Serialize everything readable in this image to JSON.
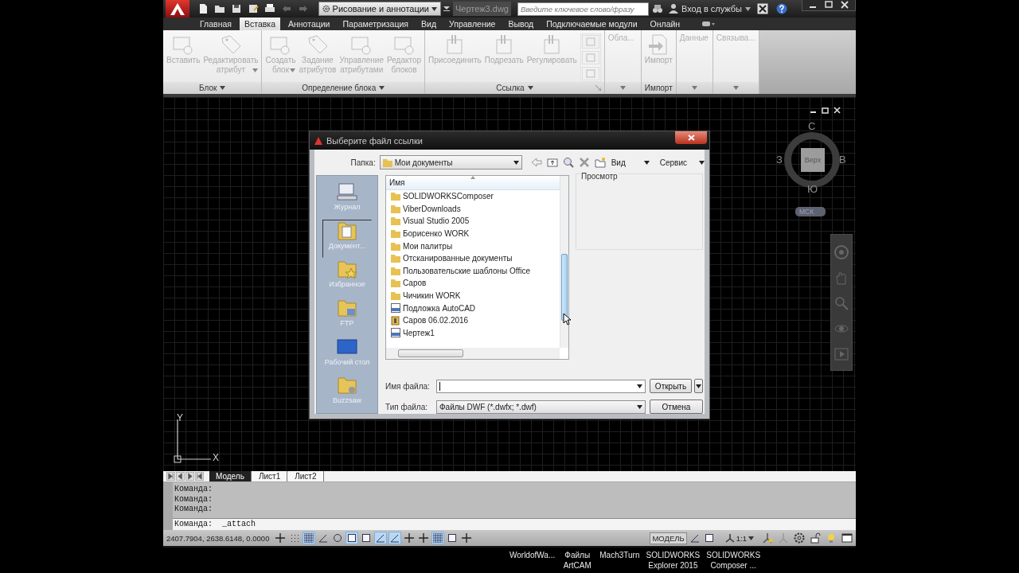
{
  "title_bar": {
    "workspace": "Рисование и аннотации",
    "document": "Чертеж3.dwg",
    "search": {
      "placeholder": "Введите ключевое слово/фразу"
    },
    "sign_in": "Вход в службы"
  },
  "ribbon_tabs": [
    {
      "label": "Главная",
      "selected": false
    },
    {
      "label": "Вставка",
      "selected": true
    },
    {
      "label": "Аннотации",
      "selected": false
    },
    {
      "label": "Параметризация",
      "selected": false
    },
    {
      "label": "Вид",
      "selected": false
    },
    {
      "label": "Управление",
      "selected": false
    },
    {
      "label": "Вывод",
      "selected": false
    },
    {
      "label": "Подключаемые модули",
      "selected": false
    },
    {
      "label": "Онлайн",
      "selected": false
    }
  ],
  "ribbon_panels": [
    {
      "kind": "full",
      "title": "Блок",
      "menu": true,
      "buttons": [
        {
          "label": "Вставить",
          "kind": "block",
          "disabled": true
        },
        {
          "label": "Редактировать атрибут",
          "kind": "tag",
          "dropdown": true,
          "disabled": true
        }
      ]
    },
    {
      "kind": "full",
      "title": "Определение блока",
      "menu": true,
      "buttons": [
        {
          "label": "Создать блок",
          "kind": "block",
          "dropdown": true,
          "disabled": true
        },
        {
          "label": "Задание атрибутов",
          "kind": "tag",
          "disabled": true
        },
        {
          "label": "Управление атрибутами",
          "kind": "block",
          "disabled": true
        },
        {
          "label": "Редактор блоков",
          "kind": "block",
          "disabled": true
        }
      ]
    },
    {
      "kind": "full",
      "title": "Ссылка",
      "menu": true,
      "launcher": true,
      "tool_column": true,
      "buttons": [
        {
          "label": "Присоединить",
          "kind": "attach",
          "disabled": true
        },
        {
          "label": "Подрезать",
          "kind": "attach",
          "disabled": true
        },
        {
          "label": "Регулировать",
          "kind": "attach",
          "disabled": true
        }
      ]
    },
    {
      "kind": "collapsed",
      "title": "Обла..."
    },
    {
      "kind": "full",
      "title": "Импорт",
      "menu": false,
      "buttons": [
        {
          "label": "Импорт",
          "kind": "import",
          "disabled": true
        }
      ]
    },
    {
      "kind": "collapsed",
      "title": "Данные"
    },
    {
      "kind": "collapsed",
      "title": "Связыва..."
    }
  ],
  "viewcube": {
    "north": "С",
    "west": "З",
    "east": "В",
    "south": "Ю",
    "face": "Верх",
    "ucs_menu": "МСК"
  },
  "ucs_icon": {
    "y_label": "Y",
    "x_label": "X"
  },
  "dialog": {
    "title": "Выберите файл ссылки",
    "folder_label": "Папка:",
    "folder": "Мои документы",
    "view_menu": "Вид",
    "tools_menu": "Сервис",
    "places": [
      {
        "label": "Журнал",
        "kind": "history",
        "selected": false
      },
      {
        "label": "Документ...",
        "kind": "documents",
        "selected": true
      },
      {
        "label": "Избранное",
        "kind": "favorites",
        "selected": false
      },
      {
        "label": "FTP",
        "kind": "ftp",
        "selected": false
      },
      {
        "label": "Рабочий стол",
        "kind": "desktop",
        "selected": false
      },
      {
        "label": "Buzzsaw",
        "kind": "buzzsaw",
        "selected": false
      }
    ],
    "list_header": "Имя",
    "files": [
      {
        "name": "SOLIDWORKSComposer",
        "kind": "folder"
      },
      {
        "name": "ViberDownloads",
        "kind": "folder"
      },
      {
        "name": "Visual Studio 2005",
        "kind": "folder"
      },
      {
        "name": "Борисенко WORK",
        "kind": "folder"
      },
      {
        "name": "Мои палитры",
        "kind": "folder"
      },
      {
        "name": "Отсканированные документы",
        "kind": "folder"
      },
      {
        "name": "Пользовательские шаблоны Office",
        "kind": "folder"
      },
      {
        "name": "Саров",
        "kind": "folder"
      },
      {
        "name": "Чичикин WORK",
        "kind": "folder"
      },
      {
        "name": "Подложка AutoCAD",
        "kind": "dwf"
      },
      {
        "name": "Саров 06.02.2016",
        "kind": "archive"
      },
      {
        "name": "Чертеж1",
        "kind": "dwf"
      }
    ],
    "preview_label": "Просмотр",
    "file_name_label": "Имя файла:",
    "file_type_label": "Тип файла:",
    "file_type": "Файлы DWF (*.dwfx; *.dwf)",
    "open_button": "Открыть",
    "cancel_button": "Отмена"
  },
  "layout_tabs": [
    {
      "label": "Модель",
      "selected": true
    },
    {
      "label": "Лист1",
      "selected": false
    },
    {
      "label": "Лист2",
      "selected": false
    }
  ],
  "command_history": [
    "Команда:",
    "Команда:",
    "Команда:"
  ],
  "command_line": "Команда:  _attach",
  "status_bar": {
    "coordinates": "2407.7904, 2638.6148, 0.0000",
    "toggles": [
      {
        "kind": "cross",
        "on": false
      },
      {
        "kind": "dots",
        "on": false
      },
      {
        "kind": "grid",
        "on": true
      },
      {
        "kind": "angle",
        "on": false
      },
      {
        "kind": "circle",
        "on": false
      },
      {
        "kind": "square",
        "on": true
      },
      {
        "kind": "square",
        "on": false
      },
      {
        "kind": "angle",
        "on": true
      },
      {
        "kind": "angle",
        "on": true
      },
      {
        "kind": "cross",
        "on": false
      },
      {
        "kind": "cross",
        "on": false
      },
      {
        "kind": "grid",
        "on": true
      },
      {
        "kind": "square",
        "on": false
      },
      {
        "kind": "cross",
        "on": false
      }
    ],
    "space": "МОДЕЛЬ",
    "scale": "1:1"
  },
  "taskbar": [
    "WorldofWa...",
    "Файлы\nArtCAM",
    "Mach3Turn",
    "SOLIDWORKS\nExplorer 2015",
    "SOLIDWORKS\nComposer ..."
  ]
}
